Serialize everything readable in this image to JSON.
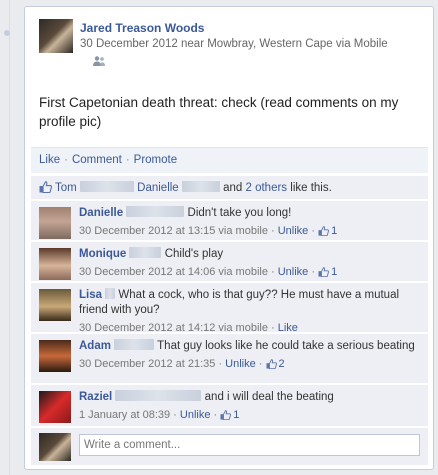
{
  "post": {
    "author": "Jared Treason Woods",
    "meta": "30 December 2012 near Mowbray, Western Cape via Mobile",
    "audience_icon": "friends-icon",
    "text": "First Capetonian death threat: check (read comments on my profile pic)"
  },
  "actions": {
    "like": "Like",
    "comment": "Comment",
    "promote": "Promote",
    "separator": "·"
  },
  "likes": {
    "name1": "Tom",
    "name2": "Danielle",
    "and": "and",
    "others_link": "2 others",
    "suffix": "like this."
  },
  "comments": [
    {
      "name": "Danielle",
      "text": "Didn't take you long!",
      "date": "30 December 2012 at 13:15 via mobile",
      "unlike": "Unlike",
      "count": "1",
      "avatar_colors": [
        "#a08070",
        "#c4a494",
        "#7e6a60"
      ]
    },
    {
      "name": "Monique",
      "text": "Child's play",
      "date": "30 December 2012 at 14:06 via mobile",
      "unlike": "Unlike",
      "count": "1",
      "avatar_colors": [
        "#5a3a2a",
        "#d8b49a",
        "#8a6a5a"
      ]
    },
    {
      "name": "Lisa",
      "text": "What a cock, who is that guy?? He must have a mutual friend with you?",
      "date": "30 December 2012 at 14:12 via mobile",
      "like": "Like",
      "avatar_colors": [
        "#6a5a3a",
        "#c8a878",
        "#3a2a1a"
      ]
    },
    {
      "name": "Adam",
      "text": "That guy looks like he could take a serious beating",
      "date": "30 December 2012 at 21:35",
      "unlike": "Unlike",
      "count": "2",
      "avatar_colors": [
        "#4a2a1a",
        "#c86a3a",
        "#2a1a12"
      ]
    },
    {
      "name": "Raziel",
      "text": "and i will deal the beating",
      "date": "1 January at 08:39",
      "unlike": "Unlike",
      "count": "1",
      "avatar_colors": [
        "#1a1a1a",
        "#d82a2a",
        "#8a1a1a"
      ]
    }
  ],
  "composer": {
    "placeholder": "Write a comment..."
  },
  "colors": {
    "link": "#3b5998",
    "panel": "#edeff4"
  }
}
